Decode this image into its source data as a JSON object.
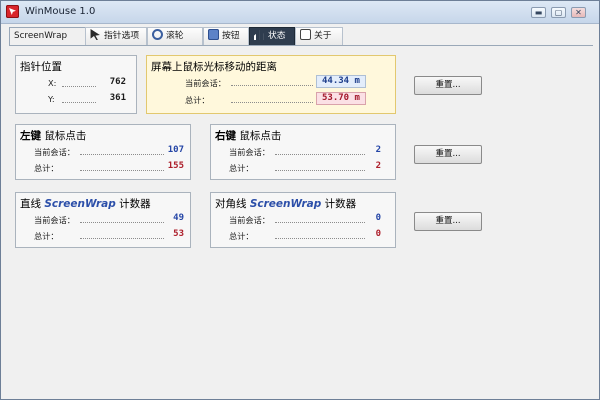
{
  "window": {
    "title": "WinMouse 1.0"
  },
  "tabs": [
    {
      "label": "ScreenWrap"
    },
    {
      "label": "指针选项"
    },
    {
      "label": "滚轮"
    },
    {
      "label": "按钮"
    },
    {
      "label": "状态"
    },
    {
      "label": "关于"
    }
  ],
  "pointer_position": {
    "title": "指针位置",
    "x_label": "X:",
    "x_value": "762",
    "y_label": "Y:",
    "y_value": "361"
  },
  "distance": {
    "title": "屏幕上鼠标光标移动的距离",
    "session_label": "当前会话：",
    "session_value": "44.34 m",
    "total_label": "总计：",
    "total_value": "53.70 m"
  },
  "left_clicks": {
    "title_strong": "左键",
    "title_rest": " 鼠标点击",
    "session_label": "当前会话：",
    "session_value": "107",
    "total_label": "总计：",
    "total_value": "155"
  },
  "right_clicks": {
    "title_strong": "右键",
    "title_rest": " 鼠标点击",
    "session_label": "当前会话：",
    "session_value": "2",
    "total_label": "总计：",
    "total_value": "2"
  },
  "line_wrap": {
    "title_pre": "直线 ",
    "title_em": "ScreenWrap",
    "title_post": " 计数器",
    "session_label": "当前会话：",
    "session_value": "49",
    "total_label": "总计：",
    "total_value": "53"
  },
  "diag_wrap": {
    "title_pre": "对角线 ",
    "title_em": "ScreenWrap",
    "title_post": " 计数器",
    "session_label": "当前会话：",
    "session_value": "0",
    "total_label": "总计：",
    "total_value": "0"
  },
  "buttons": {
    "reset_label": "重置..."
  },
  "colors": {
    "accent_blue": "#2445a6",
    "accent_red": "#ad1e2a",
    "highlight_panel": "#fff8dc"
  }
}
